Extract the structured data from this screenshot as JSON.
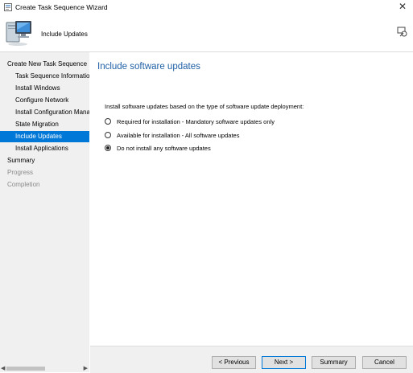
{
  "window": {
    "title": "Create Task Sequence Wizard",
    "close_glyph": "✕",
    "app_icon": "wizard-app-icon",
    "colors": {
      "accent": "#0078d7",
      "heading": "#1e5fa5",
      "sidebar_bg": "#f0f0f0"
    }
  },
  "header": {
    "title": "Include Updates",
    "icon": "computer-icon",
    "help_icon": "help-icon"
  },
  "sidebar": {
    "items": [
      {
        "label": "Create New Task Sequence",
        "level": 0,
        "state": "normal"
      },
      {
        "label": "Task Sequence Information",
        "level": 1,
        "state": "normal"
      },
      {
        "label": "Install Windows",
        "level": 1,
        "state": "normal"
      },
      {
        "label": "Configure Network",
        "level": 1,
        "state": "normal"
      },
      {
        "label": "Install Configuration Manager",
        "level": 1,
        "state": "normal"
      },
      {
        "label": "State Migration",
        "level": 1,
        "state": "normal"
      },
      {
        "label": "Include Updates",
        "level": 1,
        "state": "selected"
      },
      {
        "label": "Install Applications",
        "level": 1,
        "state": "normal"
      },
      {
        "label": "Summary",
        "level": 0,
        "state": "normal"
      },
      {
        "label": "Progress",
        "level": 0,
        "state": "dim"
      },
      {
        "label": "Completion",
        "level": 0,
        "state": "dim"
      }
    ]
  },
  "main": {
    "heading": "Include software updates",
    "prompt": "Install software updates based on the type of software update deployment:",
    "options": [
      {
        "label": "Required for installation - Mandatory software updates only",
        "selected": false
      },
      {
        "label": "Available for installation - All software updates",
        "selected": false
      },
      {
        "label": "Do not install any software updates",
        "selected": true
      }
    ]
  },
  "footer": {
    "previous": "< Previous",
    "next": "Next >",
    "summary": "Summary",
    "cancel": "Cancel"
  }
}
